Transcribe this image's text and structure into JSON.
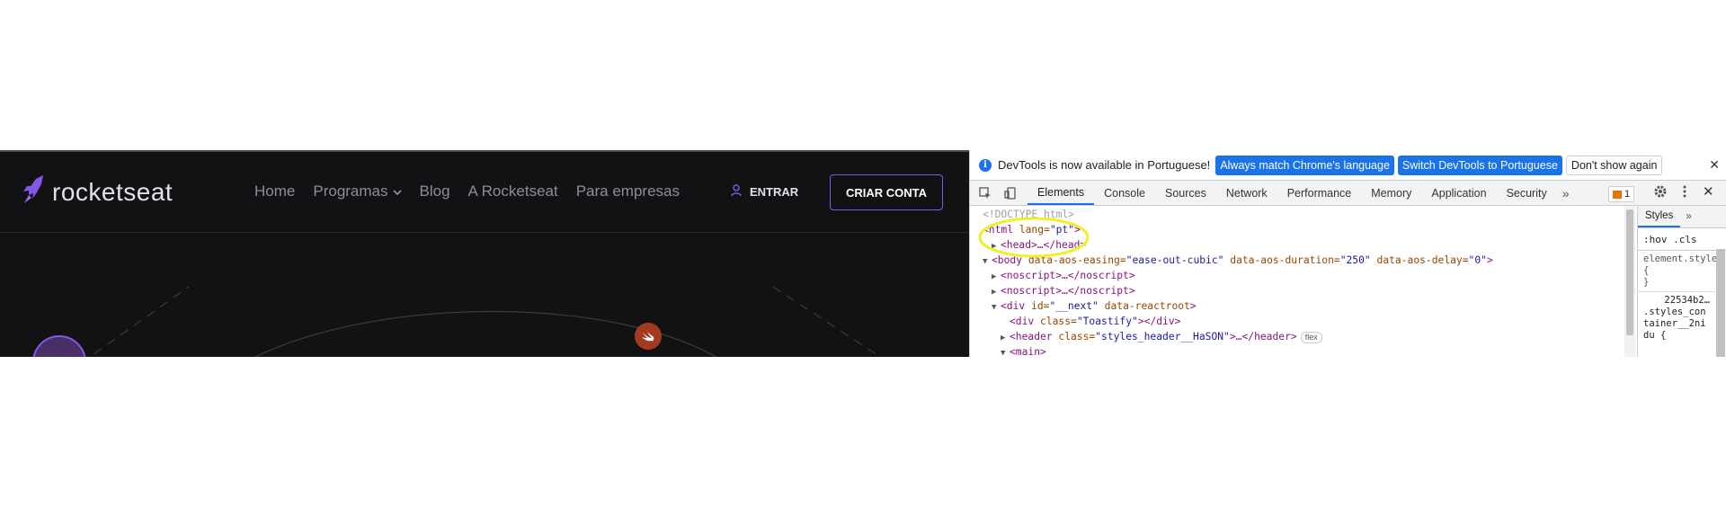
{
  "site": {
    "logo_text": "rocketseat",
    "nav": [
      {
        "label": "Home"
      },
      {
        "label": "Programas"
      },
      {
        "label": "Blog"
      },
      {
        "label": "A Rocketseat"
      },
      {
        "label": "Para empresas"
      }
    ],
    "login_label": "ENTRAR",
    "signup_label": "CRIAR CONTA",
    "accent_color": "#8257e5"
  },
  "devtools": {
    "infobar": {
      "message": "DevTools is now available in Portuguese!",
      "btn_match": "Always match Chrome's language",
      "btn_switch": "Switch DevTools to Portuguese",
      "btn_dismiss": "Don't show again"
    },
    "tabs": [
      "Elements",
      "Console",
      "Sources",
      "Network",
      "Performance",
      "Memory",
      "Application",
      "Security"
    ],
    "active_tab": "Elements",
    "issues_count": "1",
    "tree": {
      "doctype": "<!DOCTYPE html>",
      "html_tag": "<html",
      "html_attr": " lang=",
      "html_val": "\"pt\"",
      "html_close": ">",
      "head": "<head>…</head>",
      "body_open": "<body",
      "body_a1": " data-aos-easing=",
      "body_v1": "\"ease-out-cubic\"",
      "body_a2": " data-aos-duration=",
      "body_v2": "\"250\"",
      "body_a3": " data-aos-delay=",
      "body_v3": "\"0\"",
      "body_close": ">",
      "noscript1": "<noscript>…</noscript>",
      "noscript2": "<noscript>…</noscript>",
      "div_open": "<div",
      "div_a1": " id=",
      "div_v1": "\"__next\"",
      "div_a2": " data-reactroot",
      "div_close": ">",
      "toast_open": "<div",
      "toast_attr": " class=",
      "toast_val": "\"Toastify\"",
      "toast_close": "></div>",
      "header_open": "<header",
      "header_attr": " class=",
      "header_val": "\"styles_header__HaSON\"",
      "header_close": ">…</header>",
      "flex_badge": "flex",
      "main": "<main>"
    },
    "styles": {
      "tab_label": "Styles",
      "filter": ":hov .cls",
      "rule1": "element.style {",
      "rule1_end": "}",
      "rule2_src": "22534b2…",
      "rule2_sel": ".styles_container__2nidu {"
    }
  }
}
